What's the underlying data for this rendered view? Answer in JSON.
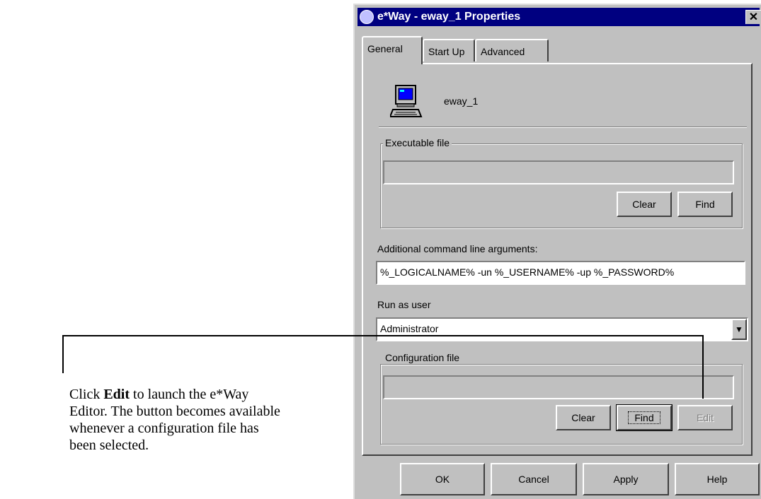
{
  "callout": {
    "prefix": "Click ",
    "bold": "Edit",
    "suffix": " to launch the e*Way Editor. The button becomes available whenever a configuration file has been selected."
  },
  "dialog": {
    "title": "e*Way - eway_1 Properties",
    "close_glyph": "✕",
    "tabs": [
      "General",
      "Start Up",
      "Advanced"
    ],
    "component_name": "eway_1",
    "executable_group": {
      "legend": "Executable file",
      "value": "",
      "clear_label": "Clear",
      "find_label": "Find"
    },
    "args_label": "Additional command line arguments:",
    "args_value": "%_LOGICALNAME%  -un %_USERNAME% -up %_PASSWORD%",
    "run_as_label": "Run as user",
    "run_as_value": "Administrator",
    "config_group": {
      "legend": "Configuration file",
      "value": "",
      "clear_label": "Clear",
      "find_label": "Find",
      "edit_label": "Edit"
    },
    "footer": {
      "ok": "OK",
      "cancel": "Cancel",
      "apply": "Apply",
      "help": "Help"
    }
  },
  "icons": {
    "title_icon": "globe-icon",
    "component_icon": "computer-icon",
    "dropdown_icon": "chevron-down-icon"
  }
}
